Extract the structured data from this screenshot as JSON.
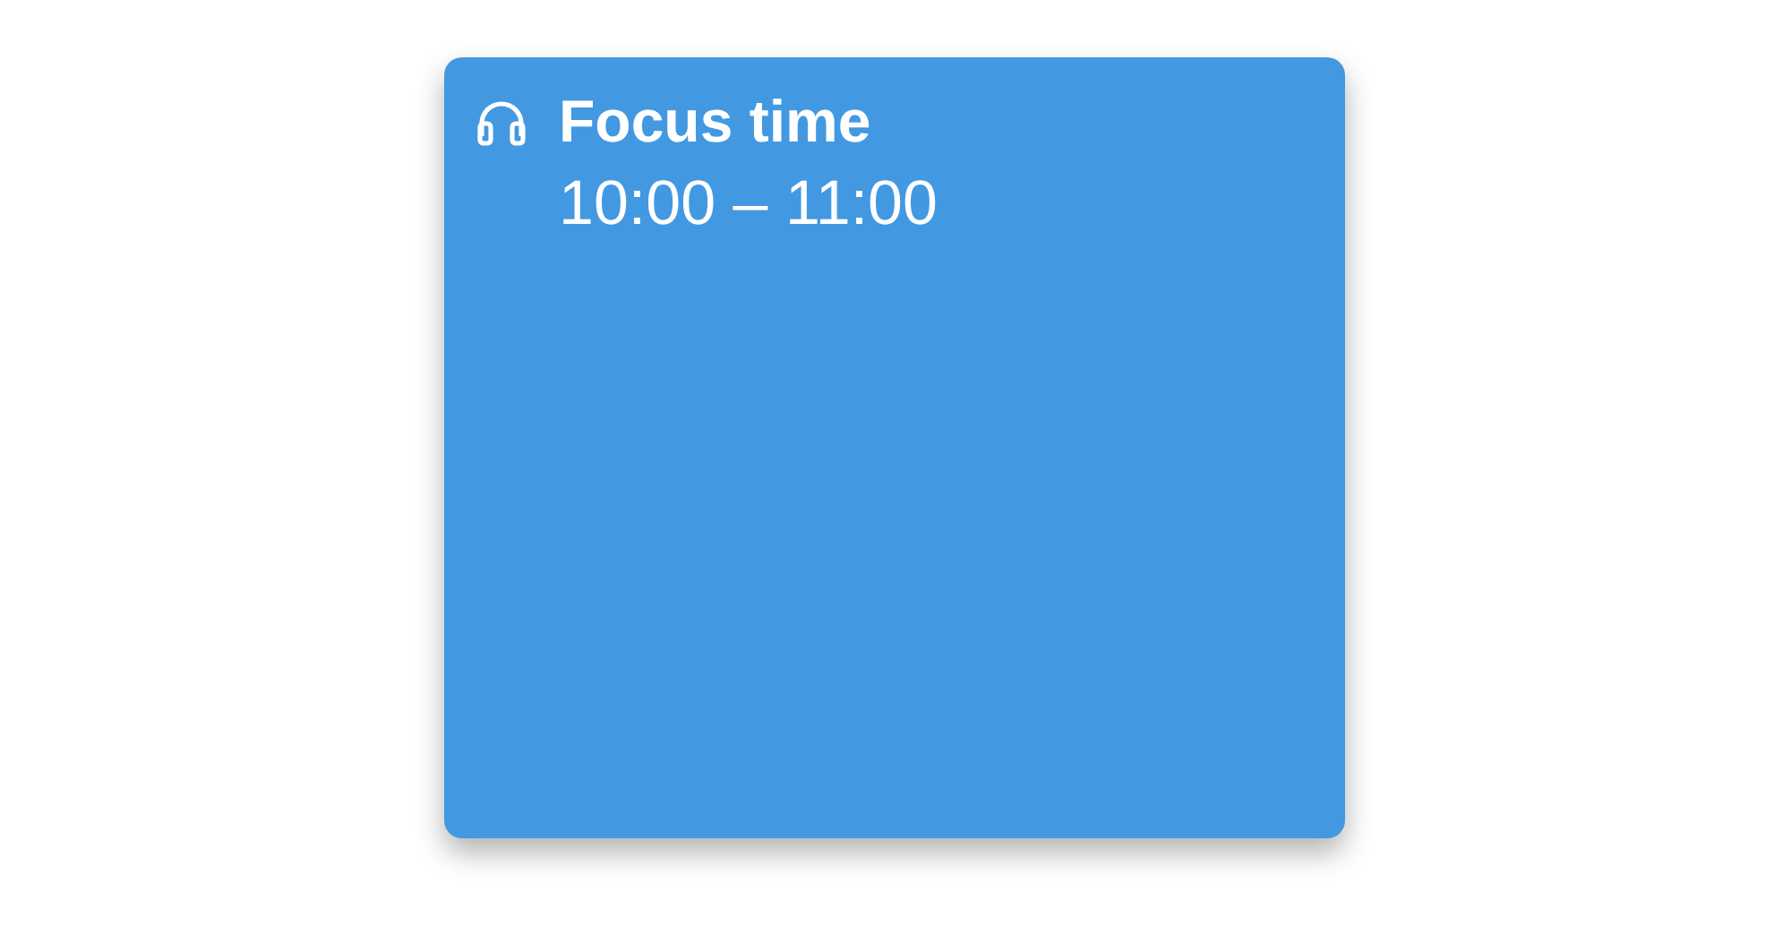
{
  "event": {
    "title": "Focus time",
    "time": "10:00 – 11:00",
    "color": "#4299e1"
  }
}
